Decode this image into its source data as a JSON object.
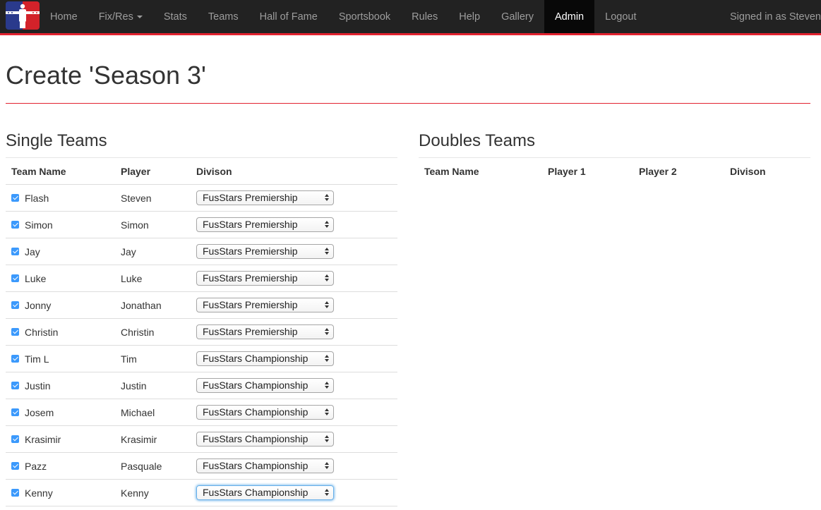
{
  "navbar": {
    "items": [
      {
        "label": "Home"
      },
      {
        "label": "Fix/Res"
      },
      {
        "label": "Stats"
      },
      {
        "label": "Teams"
      },
      {
        "label": "Hall of Fame"
      },
      {
        "label": "Sportsbook"
      },
      {
        "label": "Rules"
      },
      {
        "label": "Help"
      },
      {
        "label": "Gallery"
      },
      {
        "label": "Admin"
      },
      {
        "label": "Logout"
      }
    ],
    "active": "Admin",
    "signed_in": "Signed in as Steven"
  },
  "page": {
    "title": "Create 'Season 3'"
  },
  "colors": {
    "navbar_bg": "#222222",
    "accent_red": "#e2222f",
    "checkbox_blue": "#3b99fc"
  },
  "singles": {
    "title": "Single Teams",
    "headers": {
      "team": "Team Name",
      "player": "Player",
      "division": "Divison"
    },
    "rows": [
      {
        "team": "Flash",
        "player": "Steven",
        "division": "FusStars Premiership",
        "checked": true
      },
      {
        "team": "Simon",
        "player": "Simon",
        "division": "FusStars Premiership",
        "checked": true
      },
      {
        "team": "Jay",
        "player": "Jay",
        "division": "FusStars Premiership",
        "checked": true
      },
      {
        "team": "Luke",
        "player": "Luke",
        "division": "FusStars Premiership",
        "checked": true
      },
      {
        "team": "Jonny",
        "player": "Jonathan",
        "division": "FusStars Premiership",
        "checked": true
      },
      {
        "team": "Christin",
        "player": "Christin",
        "division": "FusStars Premiership",
        "checked": true
      },
      {
        "team": "Tim L",
        "player": "Tim",
        "division": "FusStars Championship",
        "checked": true
      },
      {
        "team": "Justin",
        "player": "Justin",
        "division": "FusStars Championship",
        "checked": true
      },
      {
        "team": "Josem",
        "player": "Michael",
        "division": "FusStars Championship",
        "checked": true
      },
      {
        "team": "Krasimir",
        "player": "Krasimir",
        "division": "FusStars Championship",
        "checked": true
      },
      {
        "team": "Pazz",
        "player": "Pasquale",
        "division": "FusStars Championship",
        "checked": true
      },
      {
        "team": "Kenny",
        "player": "Kenny",
        "division": "FusStars Championship",
        "checked": true
      }
    ]
  },
  "doubles": {
    "title": "Doubles Teams",
    "headers": {
      "team": "Team Name",
      "player1": "Player 1",
      "player2": "Player 2",
      "division": "Divison"
    }
  }
}
